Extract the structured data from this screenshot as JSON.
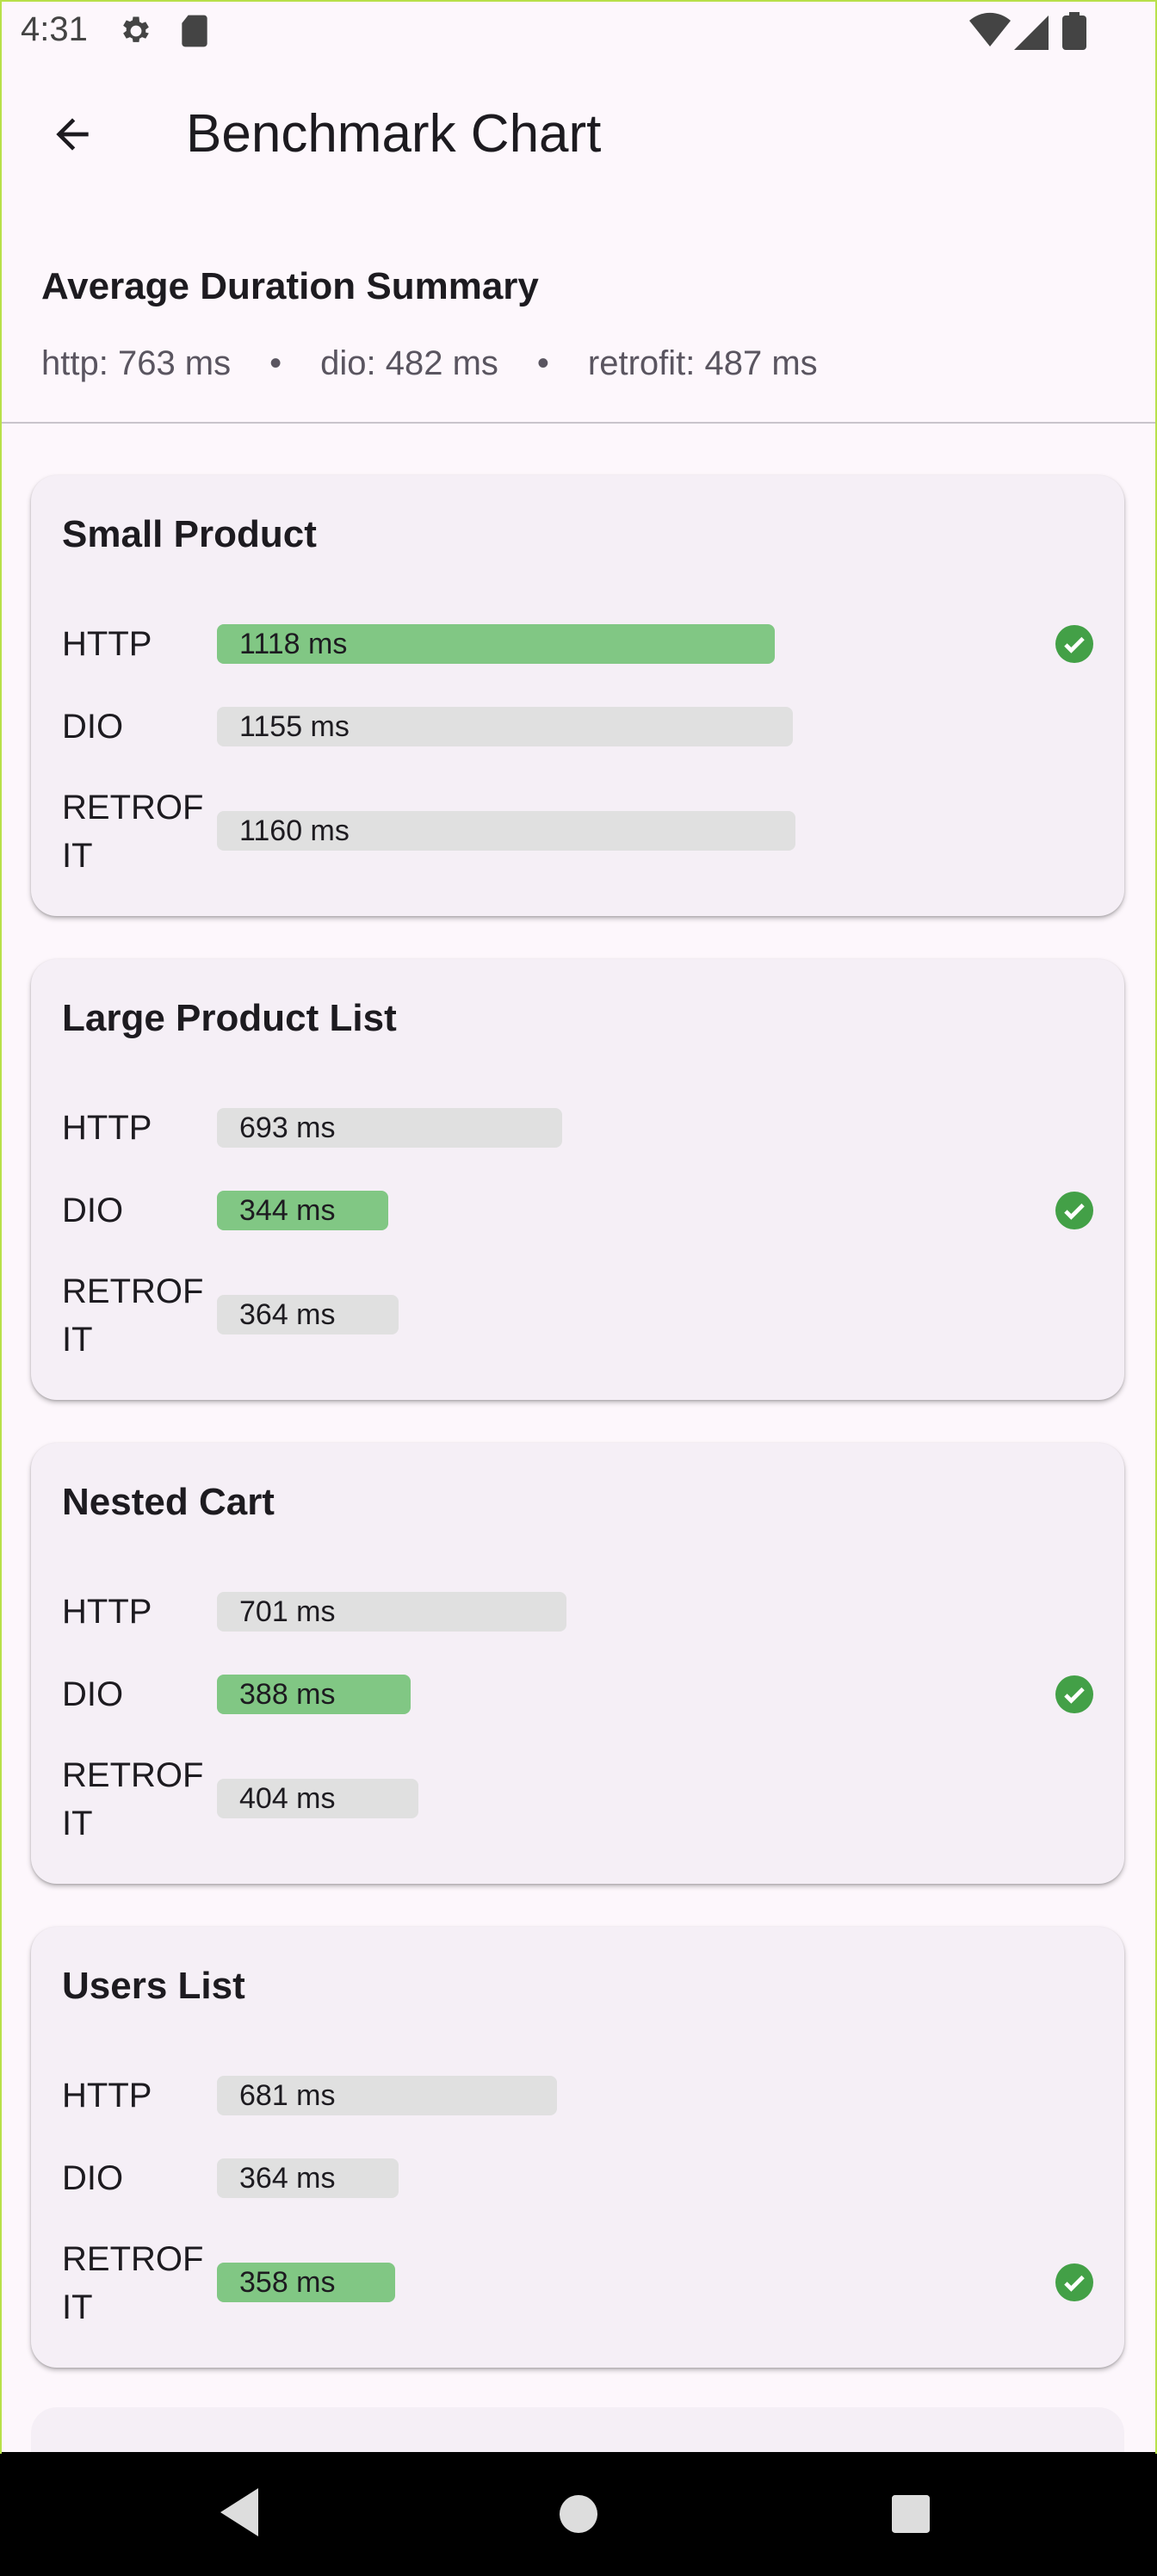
{
  "status_bar": {
    "time": "4:31",
    "icons_left": [
      "settings-icon",
      "sd-card-icon"
    ],
    "icons_right": [
      "wifi-icon",
      "signal-icon",
      "battery-icon"
    ]
  },
  "app_bar": {
    "back_icon": "arrow-back-icon",
    "title": "Benchmark Chart"
  },
  "summary": {
    "title": "Average Duration Summary",
    "items": [
      "http: 763 ms",
      "dio: 482 ms",
      "retrofit: 487 ms"
    ],
    "separator": "•"
  },
  "colors": {
    "best_bar": "#81c784",
    "bar": "#e0e0e0",
    "check": "#43a047"
  },
  "cards": [
    {
      "title": "Small Product",
      "rows": [
        {
          "label": "HTTP",
          "value": 1118,
          "text": "1118 ms",
          "best": true
        },
        {
          "label": "DIO",
          "value": 1155,
          "text": "1155 ms",
          "best": false
        },
        {
          "label": "RETROFIT",
          "value": 1160,
          "text": "1160 ms",
          "best": false
        }
      ]
    },
    {
      "title": "Large Product List",
      "rows": [
        {
          "label": "HTTP",
          "value": 693,
          "text": "693 ms",
          "best": false
        },
        {
          "label": "DIO",
          "value": 344,
          "text": "344 ms",
          "best": true
        },
        {
          "label": "RETROFIT",
          "value": 364,
          "text": "364 ms",
          "best": false
        }
      ]
    },
    {
      "title": "Nested Cart",
      "rows": [
        {
          "label": "HTTP",
          "value": 701,
          "text": "701 ms",
          "best": false
        },
        {
          "label": "DIO",
          "value": 388,
          "text": "388 ms",
          "best": true
        },
        {
          "label": "RETROFIT",
          "value": 404,
          "text": "404 ms",
          "best": false
        }
      ]
    },
    {
      "title": "Users List",
      "rows": [
        {
          "label": "HTTP",
          "value": 681,
          "text": "681 ms",
          "best": false
        },
        {
          "label": "DIO",
          "value": 364,
          "text": "364 ms",
          "best": false
        },
        {
          "label": "RETROFIT",
          "value": 358,
          "text": "358 ms",
          "best": true
        }
      ]
    }
  ],
  "nav_bar": {
    "icons": [
      "nav-back-icon",
      "nav-home-icon",
      "nav-recents-icon"
    ]
  }
}
